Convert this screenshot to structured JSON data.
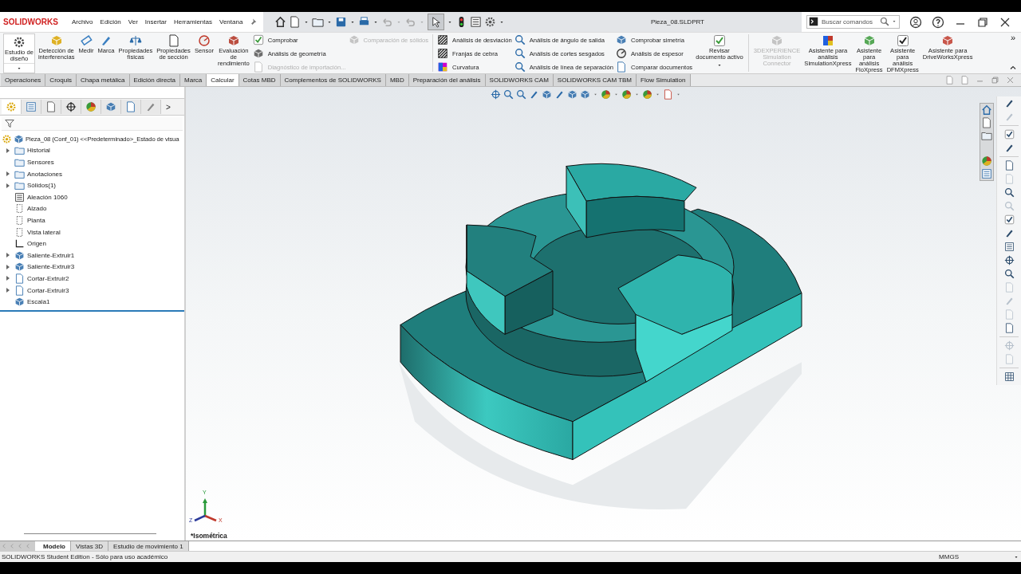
{
  "app": {
    "logo": "SOLIDWORKS",
    "menu": [
      "Archivo",
      "Edición",
      "Ver",
      "Insertar",
      "Herramientas",
      "Ventana"
    ],
    "title": "Pieza_08.SLDPRT",
    "search": {
      "placeholder": "Buscar comandos"
    }
  },
  "ribbon": {
    "design_study": {
      "label": "Estudio de\ndiseño"
    },
    "buttons": [
      {
        "label": "Detección de\ninterferencias",
        "disabled": false
      },
      {
        "label": "Medir",
        "disabled": false
      },
      {
        "label": "Marca",
        "disabled": false
      },
      {
        "label": "Propiedades\nfísicas",
        "disabled": false
      },
      {
        "label": "Propiedades\nde sección",
        "disabled": false
      },
      {
        "label": "Sensor",
        "disabled": false
      },
      {
        "label": "Evaluación\nde\nrendimiento",
        "disabled": false
      }
    ],
    "columns": [
      [
        {
          "label": "Comprobar",
          "disabled": false
        },
        {
          "label": "Análisis de geometría",
          "disabled": false
        },
        {
          "label": "Diagnóstico de importación...",
          "disabled": true
        }
      ],
      [
        {
          "label": "Comparación de sólidos",
          "disabled": true
        }
      ],
      [
        {
          "label": "Análisis de desviación",
          "disabled": false
        },
        {
          "label": "Franjas de cebra",
          "disabled": false
        },
        {
          "label": "Curvatura",
          "disabled": false
        }
      ],
      [
        {
          "label": "Análisis de ángulo de salida",
          "disabled": false
        },
        {
          "label": "Análisis de cortes sesgados",
          "disabled": false
        },
        {
          "label": "Análisis de línea de separación",
          "disabled": false
        }
      ],
      [
        {
          "label": "Comprobar simetría",
          "disabled": false
        },
        {
          "label": "Análisis de espesor",
          "disabled": false
        },
        {
          "label": "Comparar documentos",
          "disabled": false
        }
      ]
    ],
    "review": {
      "label": "Revisar\ndocumento activo"
    },
    "addins": [
      {
        "label": "3DEXPERIENCE\nSimulation\nConnector",
        "disabled": true
      },
      {
        "label": "Asistente para\nanálisis\nSimulationXpress",
        "disabled": false
      },
      {
        "label": "Asistente\npara\nanálisis\nFloXpress",
        "disabled": false
      },
      {
        "label": "Asistente\npara\nanálisis\nDFMXpress",
        "disabled": false
      },
      {
        "label": "Asistente para\nDriveWorksXpress",
        "disabled": false
      }
    ],
    "more": "»"
  },
  "command_tabs": [
    {
      "label": "Operaciones",
      "selected": false
    },
    {
      "label": "Croquis",
      "selected": false
    },
    {
      "label": "Chapa metálica",
      "selected": false
    },
    {
      "label": "Edición directa",
      "selected": false
    },
    {
      "label": "Marca",
      "selected": false
    },
    {
      "label": "Calcular",
      "selected": true
    },
    {
      "label": "Cotas MBD",
      "selected": false
    },
    {
      "label": "Complementos de SOLIDWORKS",
      "selected": false
    },
    {
      "label": "MBD",
      "selected": false
    },
    {
      "label": "Preparación del análisis",
      "selected": false
    },
    {
      "label": "SOLIDWORKS CAM",
      "selected": false
    },
    {
      "label": "SOLIDWORKS CAM TBM",
      "selected": false
    },
    {
      "label": "Flow Simulation",
      "selected": false
    }
  ],
  "panel_tabs": [
    {
      "selected": true
    },
    {
      "selected": false
    },
    {
      "selected": false
    },
    {
      "selected": false
    },
    {
      "selected": false
    },
    {
      "selected": false
    },
    {
      "selected": false
    },
    {
      "selected": false
    }
  ],
  "feature_tree": {
    "more": ">",
    "root": "Pieza_08 (Conf_01) <<Predeterminado>_Estado de visua",
    "items": [
      {
        "label": "Historial",
        "kind": "folder",
        "expanded": false
      },
      {
        "label": "Sensores",
        "kind": "folder"
      },
      {
        "label": "Anotaciones",
        "kind": "annotations",
        "expanded": false
      },
      {
        "label": "Sólidos(1)",
        "kind": "folder",
        "expanded": false
      },
      {
        "label": "Aleación 1060",
        "kind": "material"
      },
      {
        "label": "Alzado",
        "kind": "plane"
      },
      {
        "label": "Planta",
        "kind": "plane"
      },
      {
        "label": "Vista lateral",
        "kind": "plane"
      },
      {
        "label": "Origen",
        "kind": "origin"
      },
      {
        "label": "Saliente-Extruir1",
        "kind": "extrude",
        "expanded": false
      },
      {
        "label": "Saliente-Extruir3",
        "kind": "extrude",
        "expanded": false
      },
      {
        "label": "Cortar-Extruir2",
        "kind": "cut",
        "expanded": false
      },
      {
        "label": "Cortar-Extruir3",
        "kind": "cut",
        "expanded": false
      },
      {
        "label": "Escala1",
        "kind": "scale"
      }
    ]
  },
  "viewport": {
    "view_name": "*Isométrica",
    "axes": [
      "Y",
      "Z",
      "X"
    ]
  },
  "annotation_toolbar": [
    {
      "disabled": false
    },
    {
      "disabled": true
    },
    {
      "disabled": false
    },
    {
      "disabled": false
    },
    {
      "disabled": false
    },
    {
      "disabled": true
    },
    {
      "disabled": false
    },
    {
      "disabled": true
    },
    {
      "disabled": false
    },
    {
      "disabled": false
    },
    {
      "disabled": false
    },
    {
      "disabled": false
    },
    {
      "disabled": false
    },
    {
      "disabled": true
    },
    {
      "disabled": true
    },
    {
      "disabled": true
    },
    {
      "disabled": false
    },
    {
      "disabled": true
    },
    {
      "disabled": true
    },
    {
      "disabled": false
    }
  ],
  "bottom_tabs": [
    {
      "label": "Modelo",
      "selected": true
    },
    {
      "label": "Vistas 3D",
      "selected": false
    },
    {
      "label": "Estudio de movimiento 1",
      "selected": false
    }
  ],
  "status_bar": {
    "text": "SOLIDWORKS Student Edition - Sólo para uso académico",
    "units": "MMGS"
  }
}
